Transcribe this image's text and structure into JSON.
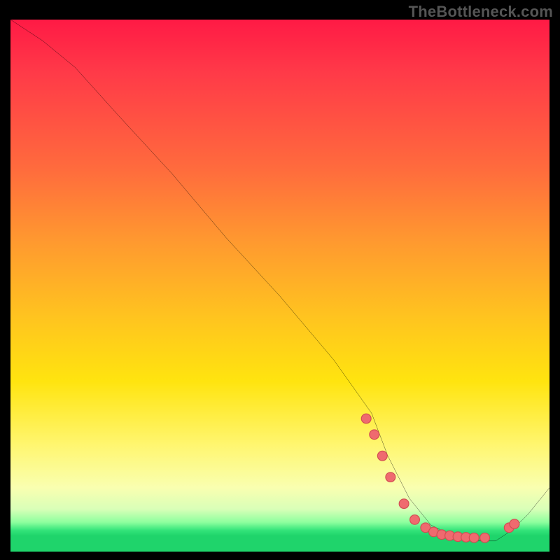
{
  "watermark": "TheBottleneck.com",
  "colors": {
    "frame_bg": "#000000",
    "curve": "#000000",
    "marker_fill": "#ef6a6f",
    "marker_stroke": "#d14c52",
    "watermark": "#555555",
    "gradient_stops": [
      "#ff1a45",
      "#ff3a48",
      "#ff6b3d",
      "#ff9a2f",
      "#ffc41f",
      "#ffe40f",
      "#fff670",
      "#f9ffb0",
      "#d9ffb8",
      "#8dff9e",
      "#33e47a",
      "#1fd46b"
    ]
  },
  "chart_data": {
    "type": "line",
    "title": "",
    "xlabel": "",
    "ylabel": "",
    "x_range": [
      0,
      100
    ],
    "y_range": [
      0,
      100
    ],
    "note": "No axis tick labels are visible; x and y expressed on 0–100 scale matching visible plot area. Curve is V-shaped: steep descent from top-left to a flat valley ~x 70–92, then short rise.",
    "series": [
      {
        "name": "bottleneck-curve",
        "x": [
          0,
          6,
          12,
          20,
          30,
          40,
          50,
          60,
          67,
          70,
          74,
          78,
          82,
          86,
          90,
          93,
          96,
          100
        ],
        "y": [
          100,
          96,
          91,
          82,
          71,
          59,
          48,
          36,
          26,
          18,
          10,
          5,
          3,
          2,
          2,
          4,
          7,
          12
        ]
      }
    ],
    "markers": {
      "name": "highlighted-points",
      "note": "Salmon-colored dots clustered along the valley and the final upslope.",
      "x": [
        66,
        67.5,
        69,
        70.5,
        73,
        75,
        77,
        78.5,
        80,
        81.5,
        83,
        84.5,
        86,
        88,
        92.5,
        93.5
      ],
      "y": [
        25,
        22,
        18,
        14,
        9,
        6,
        4.5,
        3.7,
        3.2,
        3.0,
        2.8,
        2.7,
        2.6,
        2.6,
        4.5,
        5.2
      ]
    }
  }
}
